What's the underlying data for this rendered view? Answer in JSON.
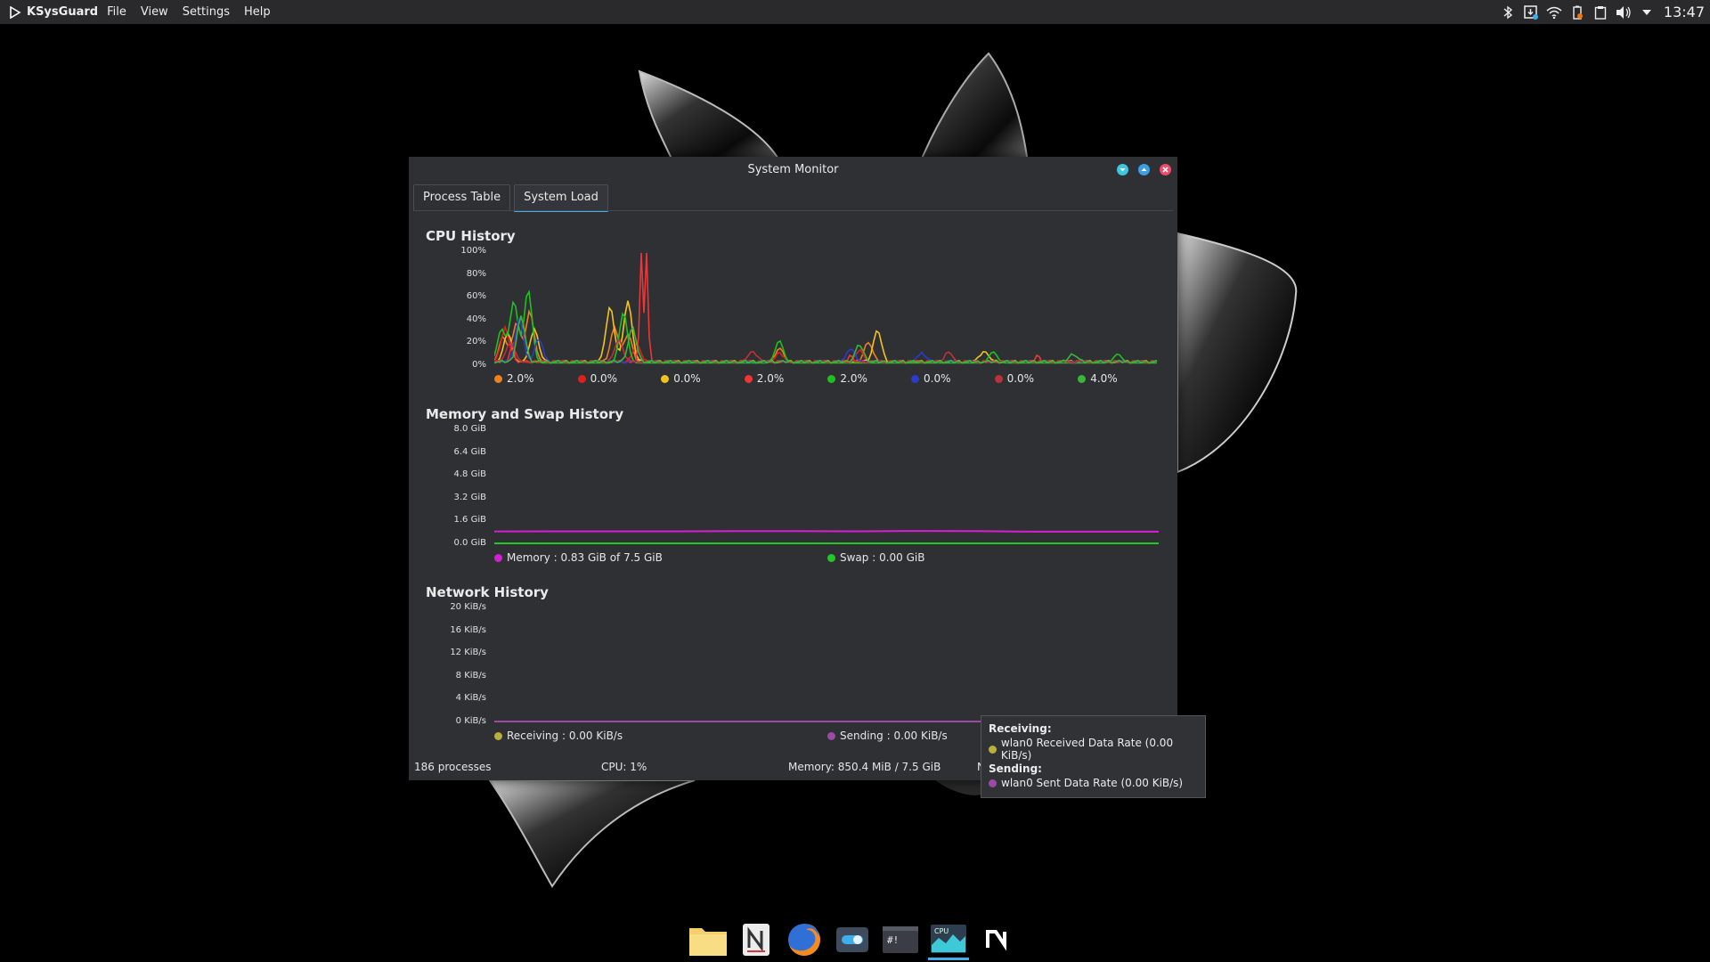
{
  "panel": {
    "app_name": "KSysGuard",
    "menu": [
      "File",
      "View",
      "Settings",
      "Help"
    ],
    "clock": "13:47",
    "tray_icons": [
      "bluetooth-icon",
      "updates-icon",
      "wifi-icon",
      "battery-icon",
      "clipboard-icon",
      "volume-icon",
      "expand-tray-icon"
    ]
  },
  "window": {
    "title": "System Monitor",
    "tabs": [
      {
        "label": "Process Table",
        "active": false
      },
      {
        "label": "System Load",
        "active": true
      }
    ]
  },
  "cpu": {
    "title": "CPU History",
    "y_ticks": [
      "100%",
      "80%",
      "60%",
      "40%",
      "20%",
      "0%"
    ],
    "legend": [
      {
        "value": "2.0%",
        "color": "#f07f1e"
      },
      {
        "value": "0.0%",
        "color": "#e02020"
      },
      {
        "value": "0.0%",
        "color": "#f2c21d"
      },
      {
        "value": "2.0%",
        "color": "#ef3535"
      },
      {
        "value": "2.0%",
        "color": "#1dc11d"
      },
      {
        "value": "0.0%",
        "color": "#2a3cc9"
      },
      {
        "value": "0.0%",
        "color": "#c0303a"
      },
      {
        "value": "4.0%",
        "color": "#39b539"
      }
    ]
  },
  "memory": {
    "title": "Memory and Swap History",
    "y_ticks": [
      "8.0 GiB",
      "6.4 GiB",
      "4.8 GiB",
      "3.2 GiB",
      "1.6 GiB",
      "0.0 GiB"
    ],
    "legend": [
      {
        "label": "Memory : 0.83 GiB of 7.5 GiB",
        "color": "#d61ed6"
      },
      {
        "label": "Swap : 0.00 GiB",
        "color": "#22c922"
      }
    ]
  },
  "network": {
    "title": "Network History",
    "y_ticks": [
      "20 KiB/s",
      "16 KiB/s",
      "12 KiB/s",
      "8 KiB/s",
      "4 KiB/s",
      "0 KiB/s"
    ],
    "legend": [
      {
        "label": "Receiving : 0.00 KiB/s",
        "color": "#b8b03a"
      },
      {
        "label": "Sending : 0.00 KiB/s",
        "color": "#9b4aa6"
      }
    ]
  },
  "statusbar": {
    "processes": "186 processes",
    "cpu": "CPU: 1%",
    "memory": "Memory: 850.4 MiB / 7.5 GiB",
    "truncated": "N"
  },
  "tooltip": {
    "receiving_header": "Receiving:",
    "receiving_line": "wlan0 Received Data Rate (0.00 KiB/s)",
    "sending_header": "Sending:",
    "sending_line": "wlan0 Sent Data Rate (0.00 KiB/s)"
  },
  "dock": {
    "items": [
      "files-icon",
      "notes-icon",
      "firefox-icon",
      "settings-toggle-icon",
      "terminal-icon",
      "system-monitor-icon",
      "n-app-icon"
    ],
    "cpu_label": "CPU",
    "terminal_label": "#!"
  },
  "chart_data": [
    {
      "type": "line",
      "title": "CPU History",
      "ylim": [
        0,
        100
      ],
      "y_unit": "%",
      "series_count": 8,
      "note_current_values": [
        "2.0%",
        "0.0%",
        "0.0%",
        "2.0%",
        "2.0%",
        "0.0%",
        "0.0%",
        "4.0%"
      ]
    },
    {
      "type": "line",
      "title": "Memory and Swap History",
      "ylim": [
        0,
        8.0
      ],
      "series": [
        {
          "name": "Memory",
          "values": [
            0.85,
            0.86,
            0.86,
            0.86,
            0.87,
            0.87,
            0.86,
            0.88,
            0.87,
            0.83,
            0.83,
            0.83
          ]
        },
        {
          "name": "Swap",
          "values": [
            0,
            0,
            0,
            0,
            0,
            0,
            0,
            0,
            0,
            0,
            0,
            0
          ]
        }
      ]
    },
    {
      "type": "line",
      "title": "Network History",
      "ylim": [
        0,
        20
      ],
      "series": [
        {
          "name": "Receiving",
          "values": [
            0,
            0,
            0,
            0,
            0,
            0,
            0,
            0,
            0,
            0,
            0,
            0
          ]
        },
        {
          "name": "Sending",
          "values": [
            0,
            0,
            0,
            0,
            0,
            0,
            0,
            0,
            0,
            0,
            0,
            0
          ]
        }
      ]
    }
  ]
}
